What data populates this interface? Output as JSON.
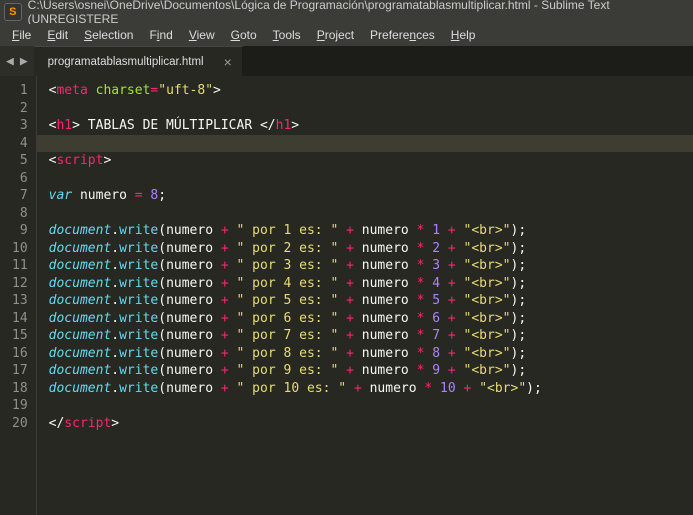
{
  "title_bar": {
    "app_icon_letter": "S",
    "path": "C:\\Users\\osnei\\OneDrive\\Documentos\\Lógica de Programación\\programatablasmultiplicar.html - Sublime Text (UNREGISTERE"
  },
  "menu": {
    "items": [
      {
        "label": "File",
        "u": "F",
        "rest": "ile"
      },
      {
        "label": "Edit",
        "u": "E",
        "rest": "dit"
      },
      {
        "label": "Selection",
        "u": "S",
        "rest": "election"
      },
      {
        "label": "Find",
        "u": "",
        "pre": "F",
        "mid": "i",
        "rest": "nd"
      },
      {
        "label": "View",
        "u": "V",
        "rest": "iew"
      },
      {
        "label": "Goto",
        "u": "G",
        "rest": "oto"
      },
      {
        "label": "Tools",
        "u": "T",
        "rest": "ools"
      },
      {
        "label": "Project",
        "u": "P",
        "rest": "roject"
      },
      {
        "label": "Preferences",
        "u": "",
        "pre": "Prefere",
        "mid": "n",
        "rest": "ces"
      },
      {
        "label": "Help",
        "u": "H",
        "rest": "elp"
      }
    ]
  },
  "nav": {
    "back": "◀",
    "forward": "▶"
  },
  "tab": {
    "name": "programatablasmultiplicar.html",
    "close": "×"
  },
  "code": {
    "active_line": 4,
    "lines": [
      {
        "n": 1,
        "k": "meta"
      },
      {
        "n": 2,
        "k": "blank"
      },
      {
        "n": 3,
        "k": "h1open"
      },
      {
        "n": 4,
        "k": "blank"
      },
      {
        "n": 5,
        "k": "scriptopen"
      },
      {
        "n": 6,
        "k": "blank"
      },
      {
        "n": 7,
        "k": "vardecl"
      },
      {
        "n": 8,
        "k": "blank"
      },
      {
        "n": 9,
        "k": "docwrite",
        "mul": 1
      },
      {
        "n": 10,
        "k": "docwrite",
        "mul": 2
      },
      {
        "n": 11,
        "k": "docwrite",
        "mul": 3
      },
      {
        "n": 12,
        "k": "docwrite",
        "mul": 4
      },
      {
        "n": 13,
        "k": "docwrite",
        "mul": 5
      },
      {
        "n": 14,
        "k": "docwrite",
        "mul": 6
      },
      {
        "n": 15,
        "k": "docwrite",
        "mul": 7
      },
      {
        "n": 16,
        "k": "docwrite",
        "mul": 8
      },
      {
        "n": 17,
        "k": "docwrite",
        "mul": 9
      },
      {
        "n": 18,
        "k": "docwrite",
        "mul": 10
      },
      {
        "n": 19,
        "k": "blank"
      },
      {
        "n": 20,
        "k": "scriptclose"
      }
    ],
    "strings": {
      "charset_attr": "charset",
      "charset_val": "\"uft-8\"",
      "h1_text": " TABLAS DE MÚLTIPLICAR ",
      "var_name": "numero",
      "var_val": "8",
      "doc_str_por": "\" por ",
      "doc_str_es": " es: \"",
      "doc_str_br": "\"<br>\"",
      "docwrite10_str": "\" por 10 es: \""
    }
  }
}
